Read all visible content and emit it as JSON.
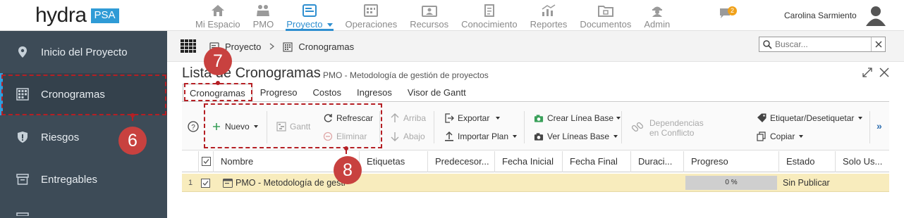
{
  "app": {
    "logo_text": "hydra",
    "logo_badge": "PSA"
  },
  "nav": {
    "items": [
      {
        "label": "Mi Espacio",
        "icon": "home-icon"
      },
      {
        "label": "PMO",
        "icon": "people-icon"
      },
      {
        "label": "Proyecto",
        "icon": "project-icon",
        "active": true
      },
      {
        "label": "Operaciones",
        "icon": "calendar-icon"
      },
      {
        "label": "Recursos",
        "icon": "resources-icon"
      },
      {
        "label": "Conocimiento",
        "icon": "knowledge-icon"
      },
      {
        "label": "Reportes",
        "icon": "reports-icon"
      },
      {
        "label": "Documentos",
        "icon": "documents-icon"
      },
      {
        "label": "Admin",
        "icon": "admin-icon"
      }
    ],
    "notification_count": "2",
    "user_name": "Carolina Sarmiento"
  },
  "sidebar": {
    "items": [
      {
        "label": "Inicio del Proyecto",
        "icon": "location-pin-icon"
      },
      {
        "label": "Cronogramas",
        "icon": "schedule-grid-icon",
        "active": true
      },
      {
        "label": "Riesgos",
        "icon": "shield-icon"
      },
      {
        "label": "Entregables",
        "icon": "archive-box-icon"
      }
    ]
  },
  "breadcrumb": {
    "items": [
      "Proyecto",
      "Cronogramas"
    ]
  },
  "search": {
    "placeholder": "Buscar..."
  },
  "page": {
    "title": "Lista de Cronogramas",
    "subtitle": "PMO - Metodología de gestión de proyectos"
  },
  "tabs": [
    "Cronogramas",
    "Progreso",
    "Costos",
    "Ingresos",
    "Visor de Gantt"
  ],
  "toolbar": {
    "nuevo": "Nuevo",
    "gantt": "Gantt",
    "refrescar": "Refrescar",
    "eliminar": "Eliminar",
    "arriba": "Arriba",
    "abajo": "Abajo",
    "exportar": "Exportar",
    "importar": "Importar Plan",
    "crear_linea": "Crear Línea Base",
    "ver_lineas": "Ver Líneas Base",
    "dependencias": "Dependencias",
    "en_conflicto": "en Conflicto",
    "etiquetar": "Etiquetar/Desetiquetar",
    "copiar": "Copiar",
    "more": "»"
  },
  "table": {
    "columns": [
      "Nombre",
      "Etiquetas",
      "Predecesor...",
      "Fecha Inicial",
      "Fecha Final",
      "Duraci...",
      "Progreso",
      "Estado",
      "Solo Us..."
    ],
    "rows": [
      {
        "index": "1",
        "nombre": "PMO - Metodología de gesti",
        "progreso": "0 %",
        "estado": "Sin Publicar"
      }
    ]
  },
  "annotations": {
    "marker_6": "6",
    "marker_7": "7",
    "marker_8": "8"
  },
  "colors": {
    "accent": "#2f8fd0",
    "sidebar": "#3d4b57",
    "annotation": "#b51f24",
    "row_highlight": "#f8ecbd"
  }
}
